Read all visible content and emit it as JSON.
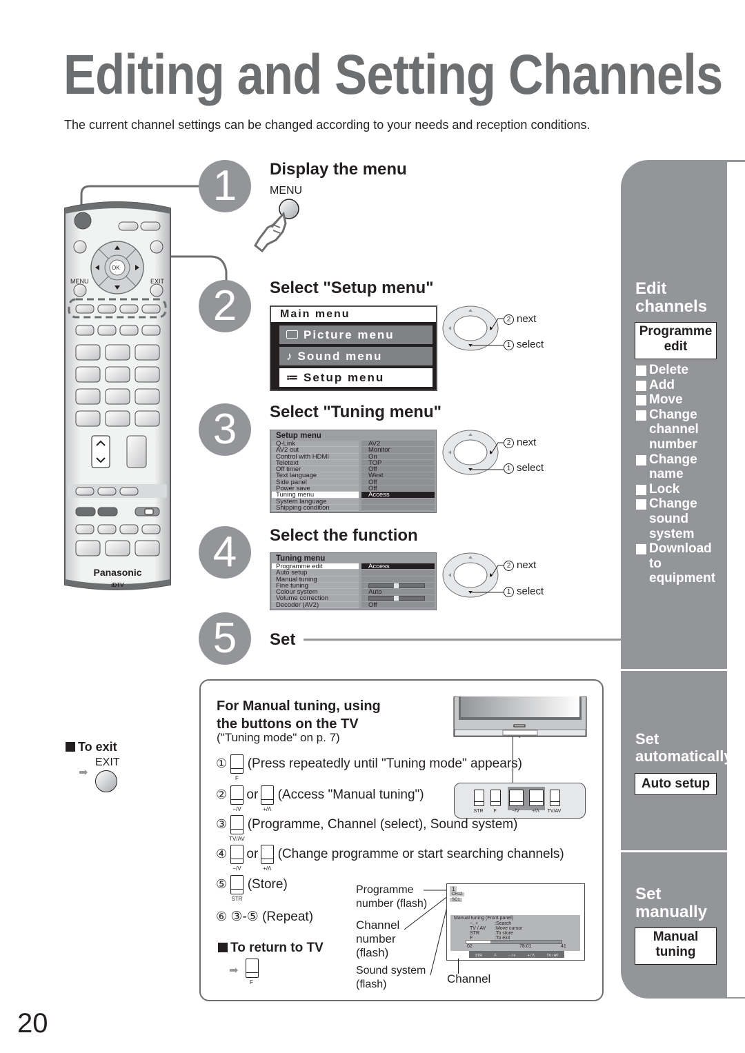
{
  "page": {
    "title": "Editing and Setting Channels",
    "subtitle": "The current channel settings can be changed according to your needs and reception conditions.",
    "page_number": "20"
  },
  "remote": {
    "menu_label": "MENU",
    "exit_label": "EXIT",
    "ok_label": "OK",
    "brand": "Panasonic",
    "model": "IDTV",
    "colors": {
      "body": "#e6e7e8",
      "dark_button": "#6d6e70"
    }
  },
  "steps": [
    {
      "number": "1",
      "heading": "Display the menu",
      "button_label": "MENU"
    },
    {
      "number": "2",
      "heading": "Select \"Setup menu\""
    },
    {
      "number": "3",
      "heading": "Select \"Tuning menu\""
    },
    {
      "number": "4",
      "heading": "Select the function"
    },
    {
      "number": "5",
      "heading": "Set"
    }
  ],
  "main_menu": {
    "title": "Main menu",
    "items": [
      {
        "icon": "picture-icon",
        "label": "Picture menu",
        "selected": false
      },
      {
        "icon": "music-note-icon",
        "label": "Sound menu",
        "selected": false
      },
      {
        "icon": "list-icon",
        "label": "Setup menu",
        "selected": true
      }
    ]
  },
  "setup_menu": {
    "title": "Setup menu",
    "rows": [
      {
        "label": "Q-Link",
        "value": "AV2"
      },
      {
        "label": "AV2 out",
        "value": "Monitor"
      },
      {
        "label": "Control with HDMI",
        "value": "On"
      },
      {
        "label": "Teletext",
        "value": "TOP"
      },
      {
        "label": "Off timer",
        "value": "Off"
      },
      {
        "label": "Text language",
        "value": "West"
      },
      {
        "label": "Side panel",
        "value": "Off"
      },
      {
        "label": "Power save",
        "value": "Off"
      },
      {
        "label": "Tuning menu",
        "value": "Access",
        "selected": true
      },
      {
        "label": "System language",
        "value": ""
      },
      {
        "label": "Shipping condition",
        "value": ""
      }
    ]
  },
  "tuning_menu": {
    "title": "Tuning menu",
    "rows": [
      {
        "label": "Programme edit",
        "value": "Access",
        "selected": true
      },
      {
        "label": "Auto setup",
        "value": ""
      },
      {
        "label": "Manual tuning",
        "value": ""
      },
      {
        "label": "Fine tuning",
        "value": "",
        "slider": 0.5
      },
      {
        "label": "Colour system",
        "value": "Auto"
      },
      {
        "label": "Volume correction",
        "value": "",
        "slider": 0.5
      },
      {
        "label": "Decoder (AV2)",
        "value": "Off"
      }
    ]
  },
  "nav_hints": {
    "next_num": "2",
    "next": "next",
    "select_num": "1",
    "select": "select"
  },
  "sidebar": {
    "edit": {
      "heading_line1": "Edit",
      "heading_line2": "channels",
      "box_line1": "Programme",
      "box_line2": "edit",
      "items": [
        {
          "lines": [
            "Delete"
          ]
        },
        {
          "lines": [
            "Add"
          ]
        },
        {
          "lines": [
            "Move"
          ]
        },
        {
          "lines": [
            "Change",
            "channel",
            "number"
          ]
        },
        {
          "lines": [
            "Change",
            "name"
          ]
        },
        {
          "lines": [
            "Lock"
          ]
        },
        {
          "lines": [
            "Change",
            "sound",
            "system"
          ]
        },
        {
          "lines": [
            "Download to",
            "equipment"
          ]
        }
      ]
    },
    "auto": {
      "heading_line1": "Set",
      "heading_line2": "automatically",
      "box": "Auto setup"
    },
    "manual": {
      "heading_line1": "Set",
      "heading_line2": "manually",
      "box_line1": "Manual",
      "box_line2": "tuning"
    },
    "colors": {
      "panel": "#939598",
      "text": "#ffffff"
    }
  },
  "to_exit": {
    "heading": "To exit",
    "button_label": "EXIT"
  },
  "manual_tuning": {
    "heading_line1": "For Manual tuning, using",
    "heading_line2": "the buttons on the TV",
    "note": "(\"Tuning mode\" on p. 7)",
    "steps": [
      {
        "num": "①",
        "buttons": [
          "F"
        ],
        "text": "(Press repeatedly until \"Tuning mode\" appears)"
      },
      {
        "num": "②",
        "buttons": [
          "−/V",
          "+/Λ"
        ],
        "joiner": "or",
        "text": "(Access \"Manual tuning\")"
      },
      {
        "num": "③",
        "buttons": [
          "TV/AV"
        ],
        "text": "(Programme, Channel (select), Sound system)"
      },
      {
        "num": "④",
        "buttons": [
          "−/V",
          "+/Λ"
        ],
        "joiner": "or",
        "text": "(Change programme or start searching channels)"
      },
      {
        "num": "⑤",
        "buttons": [
          "STR"
        ],
        "text": "(Store)"
      },
      {
        "num": "⑥",
        "text": "③-⑤ (Repeat)"
      }
    ],
    "return_heading": "To return to TV",
    "return_button": "F",
    "panel_buttons": [
      "STR",
      "F",
      "−/V",
      "+/Λ",
      "TV/AV"
    ],
    "callouts": {
      "programme": [
        "Programme",
        "number (flash)"
      ],
      "channel_num": [
        "Channel",
        "number",
        "(flash)"
      ],
      "sound": [
        "Sound system",
        "(flash)"
      ],
      "channel": "Channel"
    },
    "osd": {
      "programme": "1",
      "channel": "CH12",
      "sound": "SC1",
      "panel_title": "Manual tuning (Front panel)",
      "help": [
        {
          "k": "−, +",
          "v": "Search"
        },
        {
          "k": "TV / AV",
          "v": "Move  cursor"
        },
        {
          "k": "STR",
          "v": "To  store"
        },
        {
          "k": "F",
          "v": "To  exit"
        }
      ],
      "bar_left": "02",
      "bar_mid": "78:01",
      "bar_right": "41",
      "bar_fill": 0.25,
      "keys": [
        "STR",
        "F",
        "− / v",
        "+ / Λ",
        "TV / AV"
      ]
    }
  }
}
